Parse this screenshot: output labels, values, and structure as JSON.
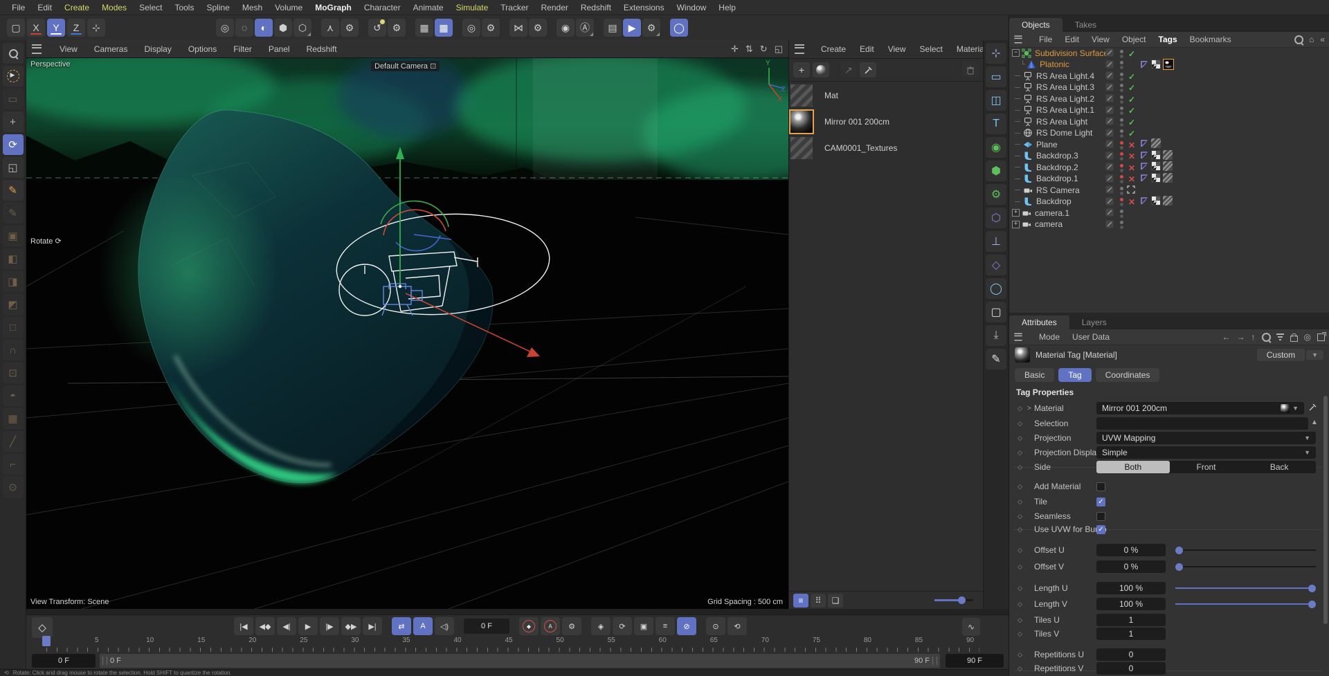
{
  "menubar": {
    "items": [
      {
        "label": "File"
      },
      {
        "label": "Edit"
      },
      {
        "label": "Create",
        "accent": true
      },
      {
        "label": "Modes",
        "accent": true
      },
      {
        "label": "Select"
      },
      {
        "label": "Tools"
      },
      {
        "label": "Spline"
      },
      {
        "label": "Mesh"
      },
      {
        "label": "Volume"
      },
      {
        "label": "MoGraph",
        "strong": true
      },
      {
        "label": "Character"
      },
      {
        "label": "Animate"
      },
      {
        "label": "Simulate",
        "accent": true
      },
      {
        "label": "Tracker"
      },
      {
        "label": "Render"
      },
      {
        "label": "Redshift"
      },
      {
        "label": "Extensions"
      },
      {
        "label": "Window"
      },
      {
        "label": "Help"
      }
    ]
  },
  "toolbar": {
    "left": [
      {
        "name": "new-project-icon",
        "glyph": "▢"
      },
      {
        "name": "lock-x-axis-button",
        "glyph": "X",
        "underline": "#c94233"
      },
      {
        "name": "lock-y-axis-button",
        "glyph": "Y",
        "underline": "#ffffff",
        "selected": true
      },
      {
        "name": "lock-z-axis-button",
        "glyph": "Z",
        "underline": "#3b78d8"
      },
      {
        "name": "workplane-tool-icon",
        "glyph": "⊹"
      }
    ],
    "groups": [
      [
        {
          "name": "gizmo-ring-icon",
          "glyph": "◎"
        },
        {
          "name": "gizmo-outline-icon",
          "glyph": "◌"
        },
        {
          "name": "coordinate-system-icon",
          "glyph": "◐",
          "selected": true
        },
        {
          "name": "shading-hexagon-icon",
          "glyph": "⬢"
        },
        {
          "name": "shading-outline-icon",
          "glyph": "⬡",
          "subtri": true
        }
      ],
      [
        {
          "name": "ik-tool-icon",
          "glyph": "⋏"
        },
        {
          "name": "ik-settings-gear-icon",
          "glyph": "⚙"
        }
      ],
      [
        {
          "name": "snap-icon",
          "glyph": "↺",
          "dot": true
        },
        {
          "name": "snap-settings-gear-icon",
          "glyph": "⚙"
        }
      ],
      [
        {
          "name": "grid-icon",
          "glyph": "▦"
        },
        {
          "name": "grid-lock-icon",
          "glyph": "▦",
          "selected": true
        }
      ],
      [
        {
          "name": "target-icon",
          "glyph": "◎"
        },
        {
          "name": "target-settings-gear-icon",
          "glyph": "⚙"
        }
      ],
      [
        {
          "name": "symmetry-icon",
          "glyph": "⋈"
        },
        {
          "name": "symmetry-settings-gear-icon",
          "glyph": "⚙"
        }
      ],
      [
        {
          "name": "render-view-icon",
          "glyph": "◉"
        },
        {
          "name": "render-settings-icon",
          "glyph": "Ⓐ",
          "subtri": true
        }
      ],
      [
        {
          "name": "picture-viewer-icon",
          "glyph": "▤"
        },
        {
          "name": "render-active-view-icon",
          "glyph": "▶",
          "selected": true
        },
        {
          "name": "render-queue-gear-icon",
          "glyph": "⚙",
          "subtri": true
        }
      ],
      [
        {
          "name": "redshift-renderview-icon",
          "glyph": "◯",
          "selected": true
        }
      ]
    ]
  },
  "left_toolbar": {
    "items": [
      {
        "name": "find-tool-icon",
        "kind": "search"
      },
      {
        "name": "live-selection-icon",
        "kind": "dashsel"
      },
      {
        "name": "rectangle-selection-icon",
        "glyph": "▭",
        "dim": true
      },
      {
        "name": "move-tool-icon",
        "glyph": "+"
      },
      {
        "name": "rotate-tool-icon",
        "glyph": "⟳",
        "selected": true
      },
      {
        "name": "scale-tool-icon",
        "glyph": "◱"
      },
      {
        "name": "pen-tool-icon",
        "glyph": "✎",
        "orange": true
      },
      {
        "name": "sketch-tool-icon",
        "glyph": "✎",
        "dim": true
      },
      {
        "name": "tweak-icon",
        "glyph": "▣",
        "dim": true
      },
      {
        "name": "points-mode-icon",
        "glyph": "◧",
        "dim": true
      },
      {
        "name": "edges-mode-icon",
        "glyph": "◨",
        "dim": true
      },
      {
        "name": "polygons-mode-icon",
        "glyph": "◩",
        "dim": true
      },
      {
        "name": "model-mode-icon",
        "glyph": "□",
        "dim": true
      },
      {
        "name": "arch-tool-icon",
        "glyph": "∩",
        "dim": true
      },
      {
        "name": "cage-deform-icon",
        "glyph": "⊡",
        "dim": true
      },
      {
        "name": "weld-mask-icon",
        "glyph": "◓",
        "dim": true
      },
      {
        "name": "extrude-cube-icon",
        "glyph": "▦",
        "dim": true
      },
      {
        "name": "knife-tool-icon",
        "glyph": "╱",
        "dim": true
      },
      {
        "name": "iron-tool-icon",
        "glyph": "⌐",
        "dim": true
      },
      {
        "name": "focus-frame-icon",
        "glyph": "⊙",
        "dim": true
      }
    ]
  },
  "viewport": {
    "menu": [
      "View",
      "Cameras",
      "Display",
      "Options",
      "Filter",
      "Panel",
      "Redshift"
    ],
    "right_icons": [
      {
        "name": "pan-view-icon",
        "glyph": "✛"
      },
      {
        "name": "dolly-view-icon",
        "glyph": "⇅"
      },
      {
        "name": "rotate-view-icon",
        "glyph": "↻"
      },
      {
        "name": "toggle-panel-icon",
        "glyph": "◱"
      }
    ],
    "labels": {
      "perspective": "Perspective",
      "default_camera": "Default Camera",
      "rotate": "Rotate",
      "view_transform": "View Transform: Scene",
      "grid_spacing": "Grid Spacing : 500 cm",
      "axis_x": "X",
      "axis_y": "Y",
      "axis_z": "Z"
    }
  },
  "materials": {
    "menu": [
      "Create",
      "Edit",
      "View",
      "Select",
      "Material"
    ],
    "items": [
      {
        "name": "Mat",
        "thumb": "stripe",
        "selected": false
      },
      {
        "name": "Mirror 001 200cm",
        "thumb": "mirror",
        "selected": true
      },
      {
        "name": "CAM0001_Textures",
        "thumb": "stripe",
        "selected": false
      }
    ]
  },
  "icon_strip": {
    "items": [
      {
        "name": "move-axis-mode-icon",
        "glyph": "⊹",
        "color": "#aab4e8"
      },
      {
        "name": "rectangle-shape-icon",
        "glyph": "▭",
        "color": "#7ec4f0"
      },
      {
        "name": "cube-primitive-icon",
        "glyph": "◫",
        "color": "#7ec4f0"
      },
      {
        "name": "text-spline-icon",
        "glyph": "T",
        "color": "#7ec4f0"
      },
      {
        "name": "subdivision-surface-icon",
        "glyph": "◉",
        "color": "#5dbf5d"
      },
      {
        "name": "cluster-icon",
        "glyph": "⬢",
        "color": "#5dbf5d"
      },
      {
        "name": "mograph-gear-icon",
        "glyph": "⚙",
        "color": "#5dbf5d",
        "dot": true
      },
      {
        "name": "field-hexagon-icon",
        "glyph": "⬡",
        "color": "#8a7fd4"
      },
      {
        "name": "axis-modify-icon",
        "glyph": "⊥",
        "color": "#9fb4e8"
      },
      {
        "name": "volume-icon",
        "glyph": "◇",
        "color": "#8a7fd4"
      },
      {
        "name": "sphere-outline-icon",
        "glyph": "◯",
        "color": "#7ec4f0"
      },
      {
        "name": "camera-object-icon",
        "glyph": "▢",
        "color": "#e0e0e0"
      },
      {
        "name": "drop-bracket-icon",
        "glyph": "⤓",
        "color": "#b8b8b8"
      },
      {
        "name": "pen-white-icon",
        "glyph": "✎",
        "color": "#e0e0e0"
      }
    ]
  },
  "objects_panel": {
    "tabs": [
      {
        "label": "Objects",
        "active": true
      },
      {
        "label": "Takes",
        "active": false
      }
    ],
    "menu": [
      {
        "label": "File"
      },
      {
        "label": "Edit"
      },
      {
        "label": "View"
      },
      {
        "label": "Object"
      },
      {
        "label": "Tags",
        "strong": true
      },
      {
        "label": "Bookmarks"
      }
    ],
    "tree": [
      {
        "name": "Subdivision Surface",
        "color": "orange",
        "icon": "subdiv",
        "expander": "minus",
        "state": "check"
      },
      {
        "name": "Platonic",
        "color": "orange",
        "icon": "pyramid",
        "child": true,
        "state": "none",
        "tags": [
          "phong",
          "checker",
          "mirror"
        ]
      },
      {
        "name": "RS Area Light.4",
        "icon": "arealight",
        "state": "check"
      },
      {
        "name": "RS Area Light.3",
        "icon": "arealight",
        "state": "check"
      },
      {
        "name": "RS Area Light.2",
        "icon": "arealight",
        "state": "check"
      },
      {
        "name": "RS Area Light.1",
        "icon": "arealight",
        "state": "check"
      },
      {
        "name": "RS Area Light",
        "icon": "arealight",
        "state": "check"
      },
      {
        "name": "RS Dome Light",
        "icon": "dome",
        "state": "check"
      },
      {
        "name": "Plane",
        "icon": "plane",
        "state": "cross",
        "tags": [
          "phong",
          "stripe"
        ]
      },
      {
        "name": "Backdrop.3",
        "icon": "backdrop",
        "state": "cross",
        "tags": [
          "phong",
          "checker",
          "stripe"
        ]
      },
      {
        "name": "Backdrop.2",
        "icon": "backdrop",
        "state": "cross",
        "tags": [
          "phong",
          "checker",
          "stripe"
        ]
      },
      {
        "name": "Backdrop.1",
        "icon": "backdrop",
        "state": "cross",
        "tags": [
          "phong",
          "checker",
          "stripe"
        ]
      },
      {
        "name": "RS Camera",
        "icon": "camera",
        "state": "render"
      },
      {
        "name": "Backdrop",
        "icon": "backdrop",
        "state": "cross",
        "tags": [
          "phong",
          "checker",
          "stripe"
        ]
      },
      {
        "name": "camera.1",
        "icon": "camera",
        "expander": "plus",
        "state": "none"
      },
      {
        "name": "camera",
        "icon": "camera",
        "expander": "plus",
        "state": "none"
      }
    ]
  },
  "attributes_panel": {
    "tabs": [
      {
        "label": "Attributes",
        "active": true
      },
      {
        "label": "Layers",
        "active": false
      }
    ],
    "menu": [
      "Mode",
      "User Data"
    ],
    "header": {
      "title": "Material Tag [Material]",
      "preset": "Custom"
    },
    "tag_tabs": [
      {
        "label": "Basic",
        "active": false
      },
      {
        "label": "Tag",
        "active": true
      },
      {
        "label": "Coordinates",
        "active": false
      }
    ],
    "section_title": "Tag Properties",
    "rows": [
      {
        "label": "Material",
        "type": "material",
        "value": "Mirror 001 200cm"
      },
      {
        "label": "Selection",
        "type": "selection",
        "value": ""
      },
      {
        "label": "Projection",
        "type": "dropdown",
        "value": "UVW Mapping"
      },
      {
        "label": "Projection Display",
        "type": "dropdown",
        "value": "Simple"
      },
      {
        "label": "Side",
        "type": "segmented",
        "value": "Both",
        "options": [
          "Both",
          "Front",
          "Back"
        ]
      },
      {
        "label": "Add Material",
        "type": "checkbox",
        "checked": false
      },
      {
        "label": "Tile",
        "type": "checkbox",
        "checked": true
      },
      {
        "label": "Seamless",
        "type": "checkbox",
        "checked": false
      },
      {
        "label": "Use UVW for Bump",
        "type": "checkbox",
        "checked": true
      },
      {
        "label": "Offset U",
        "type": "slider",
        "value": "0 %",
        "frac": 0
      },
      {
        "label": "Offset V",
        "type": "slider",
        "value": "0 %",
        "frac": 0
      },
      {
        "label": "Length U",
        "type": "slider",
        "value": "100 %",
        "frac": 1
      },
      {
        "label": "Length V",
        "type": "slider",
        "value": "100 %",
        "frac": 1
      },
      {
        "label": "Tiles U",
        "type": "number",
        "value": "1"
      },
      {
        "label": "Tiles V",
        "type": "number",
        "value": "1"
      },
      {
        "label": "Repetitions U",
        "type": "number",
        "value": "0"
      },
      {
        "label": "Repetitions V",
        "type": "number",
        "value": "0"
      }
    ]
  },
  "timeline": {
    "transport": [
      {
        "name": "go-to-start-button",
        "glyph": "|◀"
      },
      {
        "name": "previous-key-button",
        "glyph": "◀◆"
      },
      {
        "name": "previous-frame-button",
        "glyph": "◀|"
      },
      {
        "name": "play-button",
        "glyph": "▶"
      },
      {
        "name": "next-frame-button",
        "glyph": "|▶"
      },
      {
        "name": "next-key-button",
        "glyph": "◆▶"
      },
      {
        "name": "go-to-end-button",
        "glyph": "▶|"
      }
    ],
    "toggles": [
      {
        "name": "loop-playback-button",
        "glyph": "⇄",
        "selected": true
      },
      {
        "name": "play-mode-button",
        "glyph": "A",
        "selected": true
      },
      {
        "name": "sound-button",
        "glyph": "◁)"
      }
    ],
    "frame_field": "0 F",
    "record_group": [
      {
        "name": "record-keyframe-button",
        "glyph": "◆",
        "ring": true
      },
      {
        "name": "autokey-button",
        "glyph": "A",
        "ring": true
      },
      {
        "name": "keying-settings-gear-icon",
        "glyph": "⚙"
      }
    ],
    "key_group": [
      {
        "name": "key-position-button",
        "glyph": "◈"
      },
      {
        "name": "key-rotation-button",
        "glyph": "⟳"
      },
      {
        "name": "key-parameter-button",
        "glyph": "▣"
      },
      {
        "name": "key-layers-button",
        "glyph": "≡"
      },
      {
        "name": "key-filter-button",
        "glyph": "⊘",
        "selected": true
      }
    ],
    "capture_group": [
      {
        "name": "mouse-capture-button",
        "glyph": "⊙"
      },
      {
        "name": "motion-capture-button",
        "glyph": "⟲"
      }
    ],
    "ruler": {
      "start": 0,
      "end": 90,
      "step": 5,
      "current": 0
    },
    "range": {
      "start_field": "0 F",
      "bar_start": "0 F",
      "bar_end": "90 F",
      "end_field": "90 F"
    },
    "keyframe_button_glyph": "◇",
    "fcurve_icon_glyph": "∿"
  },
  "status_bar": {
    "text": "Rotate: Click and drag mouse to rotate the selection. Hold SHIFT to quantize the rotation."
  }
}
